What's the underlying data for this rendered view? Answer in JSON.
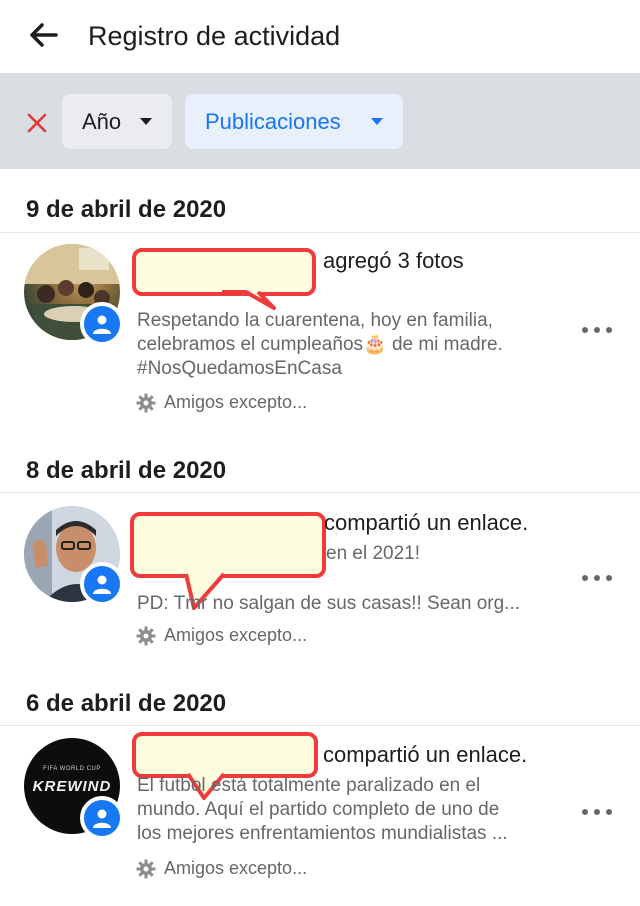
{
  "header": {
    "title": "Registro de actividad",
    "back_icon": "arrow-left-icon"
  },
  "filters": {
    "clear_icon": "close-icon",
    "year_label": "Año",
    "type_label": "Publicaciones",
    "accent_color": "#1877f2"
  },
  "posts": [
    {
      "date": "9 de abril de 2020",
      "action": "agregó 3 fotos",
      "lines": [
        "Respetando la cuarentena, hoy en familia,",
        "celebramos el cumpleaños🎂 de mi madre.",
        "#NosQuedamosEnCasa"
      ],
      "privacy": "Amigos excepto..."
    },
    {
      "date": "8 de abril de 2020",
      "action": "compartió un enlace.",
      "lines": [
        "en el 2021!",
        "PD: Tmr no salgan de sus casas!! Sean org..."
      ],
      "privacy": "Amigos excepto..."
    },
    {
      "date": "6 de abril de 2020",
      "action": "compartió un enlace.",
      "lines": [
        "El futbol está totalmente paralizado en el",
        "mundo. Aquí el partido completo de uno de",
        "los mejores enfrentamientos mundialistas ..."
      ],
      "privacy": "Amigos excepto...",
      "thumb_text": "KREWIND",
      "thumb_subtext": "FIFA WORLD CUP"
    }
  ]
}
